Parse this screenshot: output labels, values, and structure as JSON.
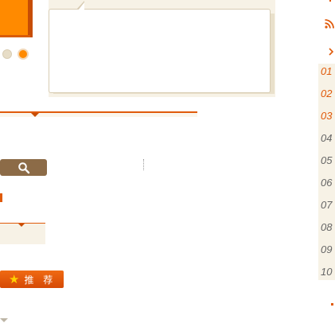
{
  "icons": {
    "search": "search-icon",
    "star": "star-icon",
    "rss": "rss-icon",
    "chevron": "chevron-right-icon"
  },
  "slider": {
    "slide_count": 2,
    "active_slide": 2
  },
  "buttons": {
    "recommend_label": "推 荐",
    "star_glyph": "★"
  },
  "ranking": {
    "numbers": [
      "01",
      "02",
      "03",
      "04",
      "05",
      "06",
      "07",
      "08",
      "09",
      "10"
    ],
    "highlighted_count": 3
  },
  "colors": {
    "accent": "#e05a0a",
    "brand_orange": "#ff8a00",
    "search_button": "#8c6b47",
    "panel_bg": "#f7f2e6"
  }
}
